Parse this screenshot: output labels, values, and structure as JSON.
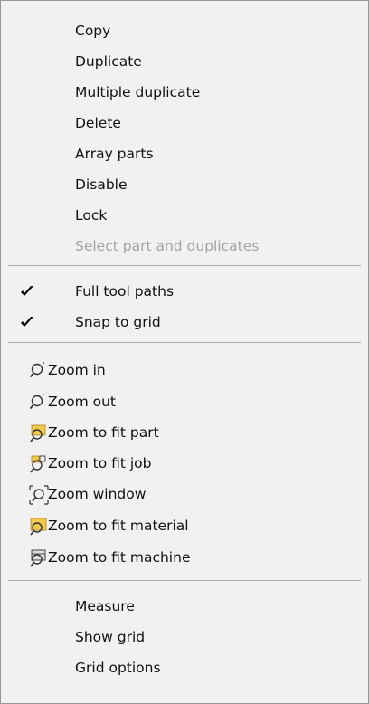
{
  "menu": {
    "group1": {
      "copy": "Copy",
      "duplicate": "Duplicate",
      "multiple_duplicate": "Multiple duplicate",
      "delete": "Delete",
      "array_parts": "Array parts",
      "disable": "Disable",
      "lock": "Lock",
      "select_part_and_duplicates": "Select part and duplicates"
    },
    "toggles": {
      "full_tool_paths": {
        "label": "Full tool paths",
        "checked": true
      },
      "snap_to_grid": {
        "label": "Snap to grid",
        "checked": true
      }
    },
    "zoom": {
      "zoom_in": {
        "label": "Zoom in",
        "icon": "zoom-in-icon"
      },
      "zoom_out": {
        "label": "Zoom out",
        "icon": "zoom-out-icon"
      },
      "zoom_to_fit_part": {
        "label": "Zoom to fit part",
        "icon": "zoom-fit-part-icon"
      },
      "zoom_to_fit_job": {
        "label": "Zoom to fit job",
        "icon": "zoom-fit-job-icon"
      },
      "zoom_window": {
        "label": "Zoom window",
        "icon": "zoom-window-icon"
      },
      "zoom_to_fit_material": {
        "label": "Zoom to fit material",
        "icon": "zoom-fit-material-icon"
      },
      "zoom_to_fit_machine": {
        "label": "Zoom to fit machine",
        "icon": "zoom-fit-machine-icon"
      }
    },
    "group4": {
      "measure": "Measure",
      "show_grid": "Show grid",
      "grid_options": "Grid options"
    }
  },
  "colors": {
    "menu_bg": "#f1f1f1",
    "disabled_text": "#a3a3a3",
    "separator": "#a7a7a7",
    "icon_yellow": "#f2c94c"
  }
}
